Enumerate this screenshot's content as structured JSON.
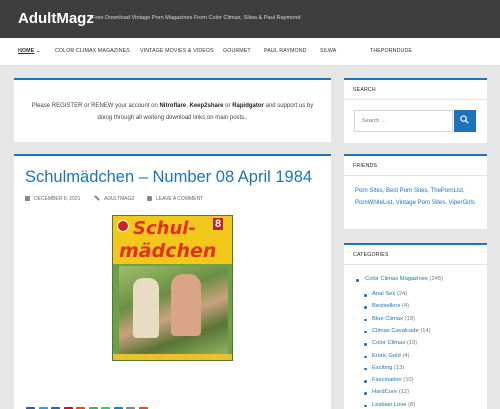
{
  "site": {
    "title": "AdultMagz",
    "description": "Free Download Vintage Porn Magazines From Color Climax, Silwa & Paul Raymond"
  },
  "nav": {
    "home": "HOME",
    "items": [
      "COLOR CLIMAX MAGAZINES",
      "VINTAGE MOVIES & VIDEOS",
      "GOURMET",
      "PAUL RAYMOND",
      "SILWA",
      "THEPORNDUDE"
    ]
  },
  "notice": {
    "prefix": "Please REGISTER or RENEW your account on ",
    "host1": "Nitroflare",
    "sep1": ", ",
    "host2": "Keep2share",
    "sep2": " or ",
    "host3": "Rapidgator",
    "suffix": " and support us by doing through all working download links on main posts.."
  },
  "post": {
    "title": "Schulmädchen – Number 08 April 1984",
    "date": "DECEMBER 6, 2021",
    "author": "ADULTMAGZ",
    "comments": "LEAVE A COMMENT",
    "cover": {
      "title_line1": "Schul-",
      "title_line2": "mädchen",
      "number": "8"
    },
    "share_colors": [
      "#3b5998",
      "#1da1f2",
      "#2867b2",
      "#e60023",
      "#ff4500",
      "#4caf50",
      "#25d366",
      "#0088cc",
      "#888888",
      "#dd4b39"
    ]
  },
  "search": {
    "title": "SEARCH",
    "placeholder": "Search …"
  },
  "friends": {
    "title": "FRIENDS",
    "text": "Porn Sites, Best Porn Sites, ThePornList, PornWhiteList, Vintage Porn Sites, ViperGirls"
  },
  "categories": {
    "title": "CATEGORIES",
    "parent": {
      "label": "Color Climax Magazines",
      "count": "(245)"
    },
    "items": [
      {
        "label": "Anal Sex",
        "count": "(24)"
      },
      {
        "label": "Bestsellers",
        "count": "(4)"
      },
      {
        "label": "Blue Climax",
        "count": "(19)"
      },
      {
        "label": "Climax Cavalcade",
        "count": "(14)"
      },
      {
        "label": "Color Climax",
        "count": "(19)"
      },
      {
        "label": "Erotic Gold",
        "count": "(4)"
      },
      {
        "label": "Exciting",
        "count": "(13)"
      },
      {
        "label": "Fascination",
        "count": "(10)"
      },
      {
        "label": "HardCore",
        "count": "(12)"
      },
      {
        "label": "Lesbian Love",
        "count": "(8)"
      }
    ]
  },
  "colors": {
    "accent": "#1e73be",
    "topbar": "#3e3e3e",
    "background": "#e6e6e6"
  }
}
